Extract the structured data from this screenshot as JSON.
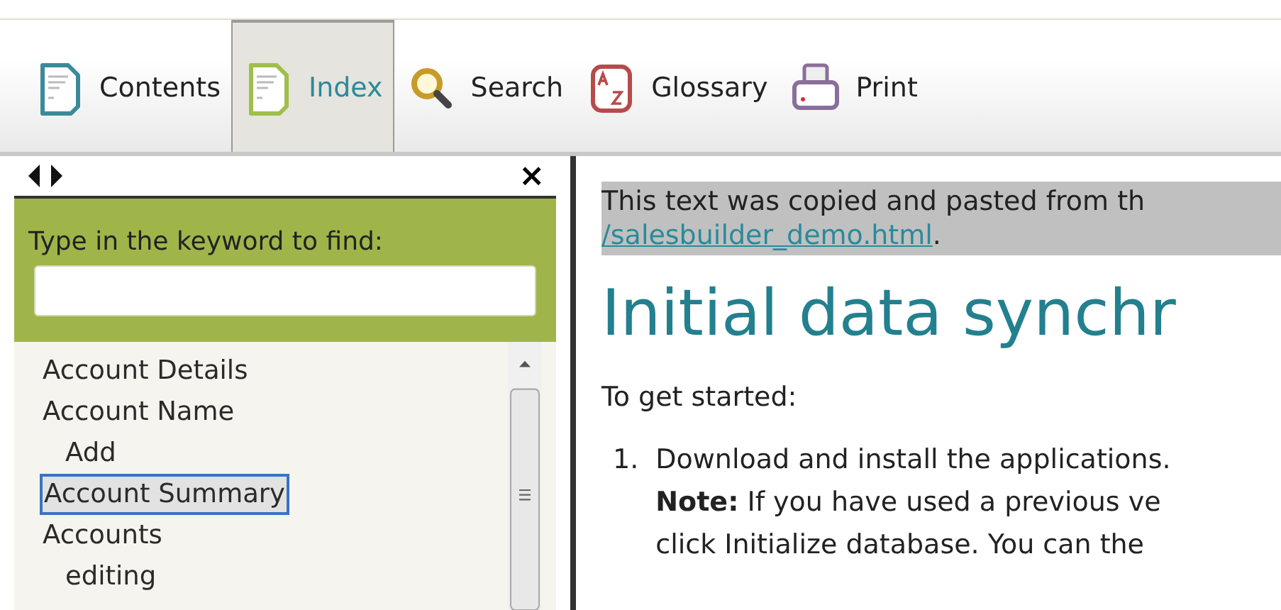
{
  "toolbar": {
    "tabs": [
      {
        "label": "Contents",
        "kind": "contents",
        "selected": false
      },
      {
        "label": "Index",
        "kind": "index",
        "selected": true
      },
      {
        "label": "Search",
        "kind": "search",
        "selected": false
      },
      {
        "label": "Glossary",
        "kind": "glossary",
        "selected": false
      },
      {
        "label": "Print",
        "kind": "print",
        "selected": false
      }
    ]
  },
  "index_panel": {
    "close": "×",
    "search": {
      "label": "Type in the keyword to find:"
    },
    "items": [
      {
        "label": "Account Details",
        "selected": false
      },
      {
        "label": "Account Name",
        "selected": false,
        "children": [
          {
            "label": "Add",
            "selected": false
          }
        ]
      },
      {
        "label": "Account Summary",
        "selected": true
      },
      {
        "label": "Accounts",
        "selected": false,
        "children": [
          {
            "label": "editing",
            "selected": false
          }
        ]
      }
    ]
  },
  "content": {
    "note": "This text was copied and pasted from th",
    "link": "/salesbuilder_demo.html",
    "link_suffix": ".",
    "heading": "Initial data synchr",
    "intro": "To get started:",
    "steps": [
      {
        "number": "1.",
        "lines": [
          "Download and install the applications.",
          "**Note:** If you have used a previous ve",
          "click Initialize database. You can the"
        ]
      }
    ]
  }
}
